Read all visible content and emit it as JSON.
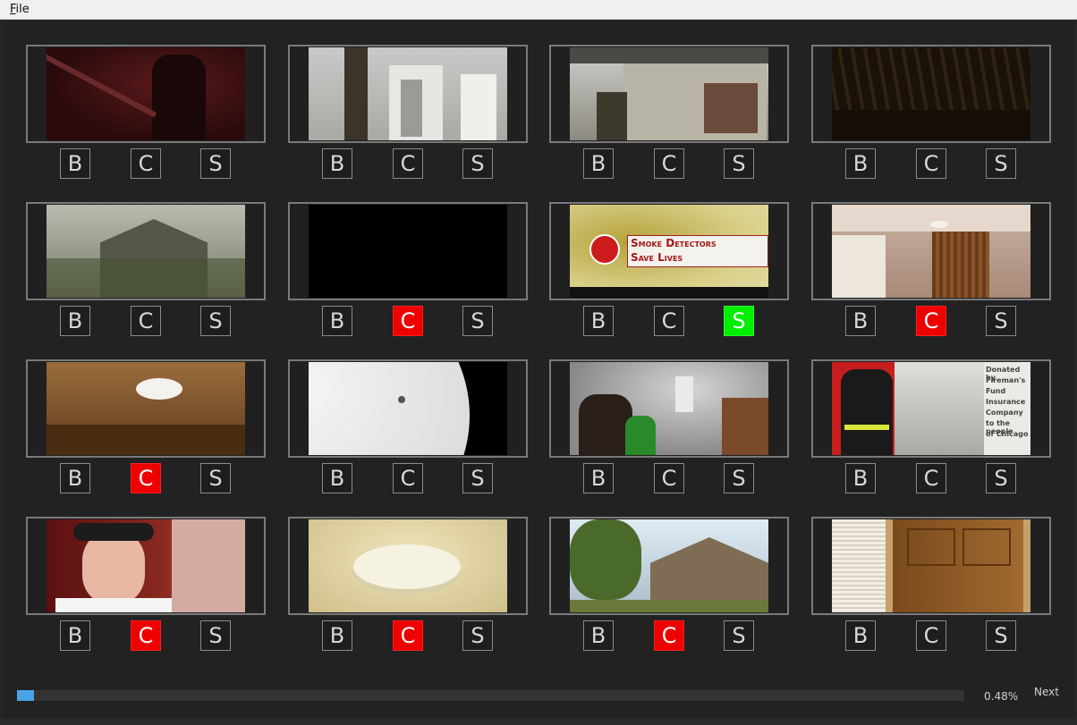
{
  "menubar": {
    "file_label_mnemonic": "F",
    "file_label_rest": "ile"
  },
  "buttons": {
    "b": "B",
    "c": "C",
    "s": "S"
  },
  "colors": {
    "selected_c": "#ee0000",
    "selected_s": "#00ee00",
    "progress": "#4aa3e8"
  },
  "thumbnails": [
    {
      "scene": "firefighter-dark-red-room",
      "b": false,
      "c": false,
      "s": false
    },
    {
      "scene": "man-entering-porch-door",
      "b": false,
      "c": false,
      "s": false
    },
    {
      "scene": "porch-exterior-man-at-door",
      "b": false,
      "c": false,
      "s": false
    },
    {
      "scene": "dark-burned-ceiling",
      "b": false,
      "c": false,
      "s": false
    },
    {
      "scene": "house-fire-escape-overlay",
      "b": false,
      "c": false,
      "s": false
    },
    {
      "scene": "black-frame",
      "b": false,
      "c": true,
      "s": false
    },
    {
      "scene": "smoke-detectors-title-card",
      "title_line1": "Smoke Detectors",
      "title_line2": "Save Lives",
      "b": false,
      "c": false,
      "s": true
    },
    {
      "scene": "ceiling-with-smoke-detector",
      "b": false,
      "c": true,
      "s": false
    },
    {
      "scene": "smoke-detector-on-ceiling-closeup",
      "b": false,
      "c": true,
      "s": false
    },
    {
      "scene": "smoke-detector-extreme-closeup",
      "b": false,
      "c": false,
      "s": false
    },
    {
      "scene": "smoky-room-with-people",
      "b": false,
      "c": false,
      "s": false
    },
    {
      "scene": "firefighter-and-child-sponsor-card",
      "sponsor_text": [
        "Donated by",
        "Fireman's",
        "Fund",
        "Insurance",
        "Company",
        "to the people",
        "of Chicago"
      ],
      "b": false,
      "c": false,
      "s": false
    },
    {
      "scene": "firefighter-speaking",
      "b": false,
      "c": true,
      "s": false
    },
    {
      "scene": "smoke-detector-beige",
      "b": false,
      "c": true,
      "s": false
    },
    {
      "scene": "house-with-trees",
      "b": false,
      "c": true,
      "s": false
    },
    {
      "scene": "wooden-door-and-louvered-closet",
      "b": false,
      "c": false,
      "s": false
    }
  ],
  "progress": {
    "value": 0.0048,
    "label": "0.48%"
  },
  "next_label": "Next"
}
